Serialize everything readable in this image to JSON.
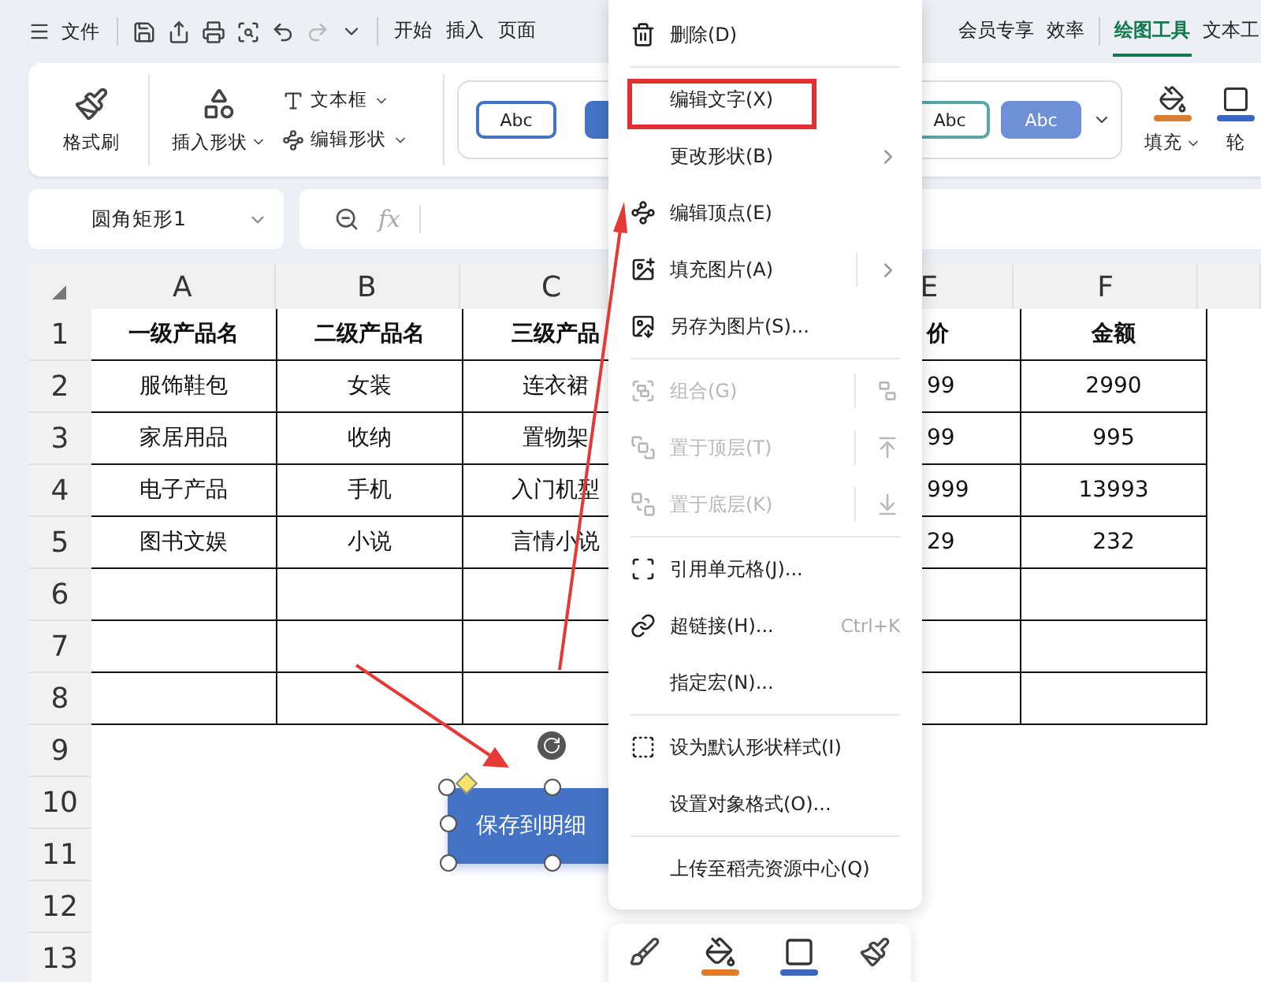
{
  "menu_bar": {
    "file_label": "文件",
    "tab_groups": [
      [
        {
          "label": "开始",
          "selected": false
        },
        {
          "label": "插入",
          "selected": false
        },
        {
          "label": "页面",
          "selected": false
        }
      ],
      [
        {
          "label": "会员专享",
          "selected": false
        },
        {
          "label": "效率",
          "selected": false
        },
        {
          "label": "绘图工具",
          "selected": true
        },
        {
          "label": "文本工",
          "selected": false
        }
      ]
    ]
  },
  "ribbon": {
    "format_painter": "格式刷",
    "insert_shape": "插入形状",
    "text_box": "文本框",
    "edit_shape": "编辑形状",
    "styles_left": [
      {
        "label": "Abc",
        "kind": "outline",
        "color": "#4472c4"
      },
      {
        "kind": "filled",
        "color": "#4472c4"
      }
    ],
    "styles_right": [
      {
        "label": "Abc",
        "kind": "outline",
        "color": "#5aa5a8"
      },
      {
        "label": "Abc",
        "kind": "filled",
        "color": "#6f8fd6"
      }
    ],
    "fill": "填充",
    "outline": "轮"
  },
  "formula_bar": {
    "name_box": "圆角矩形1",
    "fx": "fx"
  },
  "sheet": {
    "columns": [
      "A",
      "B",
      "C",
      null,
      "E",
      "F"
    ],
    "rows": [
      {
        "header": "1",
        "bordered": true,
        "bold": true,
        "cells": [
          "一级产品名",
          "二级产品名",
          "三级产品",
          null,
          "价",
          "金额"
        ]
      },
      {
        "header": "2",
        "bordered": true,
        "cells": [
          "服饰鞋包",
          "女装",
          "连衣裙",
          null,
          "99",
          "2990"
        ]
      },
      {
        "header": "3",
        "bordered": true,
        "cells": [
          "家居用品",
          "收纳",
          "置物架",
          null,
          "99",
          "995"
        ]
      },
      {
        "header": "4",
        "bordered": true,
        "cells": [
          "电子产品",
          "手机",
          "入门机型",
          null,
          "999",
          "13993"
        ]
      },
      {
        "header": "5",
        "bordered": true,
        "cells": [
          "图书文娱",
          "小说",
          "言情小说",
          null,
          "29",
          "232"
        ]
      },
      {
        "header": "6",
        "bordered": true
      },
      {
        "header": "7",
        "bordered": true
      },
      {
        "header": "8",
        "bordered": true
      },
      {
        "header": "9",
        "bordered": false
      },
      {
        "header": "10",
        "bordered": false
      },
      {
        "header": "11",
        "bordered": false
      },
      {
        "header": "12",
        "bordered": false
      },
      {
        "header": "13",
        "bordered": false
      }
    ]
  },
  "shape": {
    "text": "保存到明细"
  },
  "context_menu": [
    {
      "kind": "item",
      "label": "删除(D)",
      "disabled": false,
      "highlighted": false
    },
    {
      "kind": "separator"
    },
    {
      "kind": "item",
      "label": "编辑文字(X)",
      "disabled": false,
      "highlighted": true
    },
    {
      "kind": "item",
      "label": "更改形状(B)",
      "disabled": false,
      "highlighted": false,
      "submenu": true
    },
    {
      "kind": "item",
      "label": "编辑顶点(E)",
      "disabled": false,
      "highlighted": false
    },
    {
      "kind": "item",
      "label": "填充图片(A)",
      "disabled": false,
      "highlighted": false,
      "submenu": true
    },
    {
      "kind": "item",
      "label": "另存为图片(S)...",
      "disabled": false,
      "highlighted": false
    },
    {
      "kind": "separator"
    },
    {
      "kind": "item",
      "label": "组合(G)",
      "disabled": true,
      "highlighted": false
    },
    {
      "kind": "item",
      "label": "置于顶层(T)",
      "disabled": true,
      "highlighted": false
    },
    {
      "kind": "item",
      "label": "置于底层(K)",
      "disabled": true,
      "highlighted": false
    },
    {
      "kind": "separator"
    },
    {
      "kind": "item",
      "label": "引用单元格(J)...",
      "disabled": false,
      "highlighted": false
    },
    {
      "kind": "item",
      "label": "超链接(H)...",
      "disabled": false,
      "highlighted": false,
      "shortcut": "Ctrl+K"
    },
    {
      "kind": "item",
      "label": "指定宏(N)...",
      "disabled": false,
      "highlighted": false
    },
    {
      "kind": "separator"
    },
    {
      "kind": "item",
      "label": "设为默认形状样式(I)",
      "disabled": false,
      "highlighted": false
    },
    {
      "kind": "item",
      "label": "设置对象格式(O)...",
      "disabled": false,
      "highlighted": false
    },
    {
      "kind": "separator"
    },
    {
      "kind": "item",
      "label": "上传至稻壳资源中心(Q)",
      "disabled": false,
      "highlighted": false
    }
  ]
}
